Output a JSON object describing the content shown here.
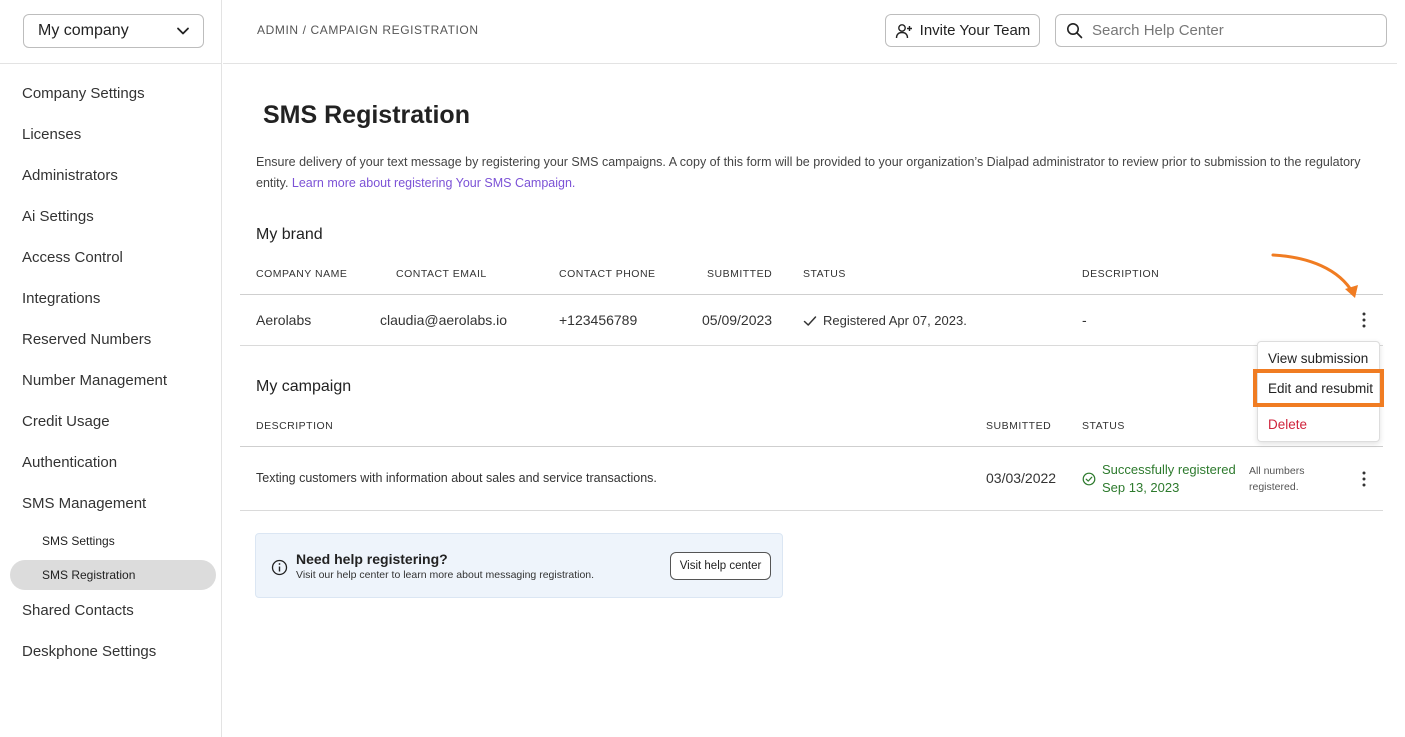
{
  "company_selector": {
    "label": "My company"
  },
  "sidebar": {
    "items": [
      {
        "label": "Company Settings"
      },
      {
        "label": "Licenses"
      },
      {
        "label": "Administrators"
      },
      {
        "label": "Ai Settings"
      },
      {
        "label": "Access Control"
      },
      {
        "label": "Integrations"
      },
      {
        "label": "Reserved Numbers"
      },
      {
        "label": "Number Management"
      },
      {
        "label": "Credit Usage"
      },
      {
        "label": "Authentication"
      },
      {
        "label": "SMS Management"
      }
    ],
    "sub_items": [
      {
        "label": "SMS Settings"
      },
      {
        "label": "SMS Registration"
      }
    ],
    "items_after": [
      {
        "label": "Shared Contacts"
      },
      {
        "label": "Deskphone Settings"
      }
    ]
  },
  "header": {
    "breadcrumb": "ADMIN / CAMPAIGN REGISTRATION",
    "invite_label": "Invite Your Team",
    "search_placeholder": "Search Help Center"
  },
  "page": {
    "title": "SMS Registration",
    "intro": "Ensure delivery of your text message by registering your SMS campaigns. A copy of this form will be provided to your organization’s Dialpad administrator to review prior to submission to the regulatory entity.",
    "intro_link": "Learn more about registering Your SMS Campaign."
  },
  "brand": {
    "title": "My brand",
    "columns": {
      "company_name": "COMPANY NAME",
      "contact_email": "CONTACT EMAIL",
      "contact_phone": "CONTACT PHONE",
      "submitted": "SUBMITTED",
      "status": "STATUS",
      "description": "DESCRIPTION"
    },
    "row": {
      "company_name": "Aerolabs",
      "contact_email": "claudia@aerolabs.io",
      "contact_phone": "+123456789",
      "submitted": "05/09/2023",
      "status": "Registered Apr 07, 2023.",
      "description": "-"
    }
  },
  "menu": {
    "view": "View submission",
    "edit": "Edit and resubmit",
    "delete": "Delete"
  },
  "campaign": {
    "title": "My campaign",
    "columns": {
      "description": "DESCRIPTION",
      "submitted": "SUBMITTED",
      "status": "STATUS"
    },
    "row": {
      "description": "Texting customers with information about sales and service transactions.",
      "submitted": "03/03/2022",
      "status_line1": "Successfully registered",
      "status_line2": "Sep 13, 2023",
      "note_line1": "All numbers",
      "note_line2": "registered."
    }
  },
  "help": {
    "title": "Need help registering?",
    "text": "Visit our help center to learn more about messaging registration.",
    "button": "Visit help center"
  },
  "colors": {
    "accent_link": "#7c52d6",
    "success": "#2d7a2d",
    "danger": "#d0243c",
    "highlight": "#f07c22"
  }
}
